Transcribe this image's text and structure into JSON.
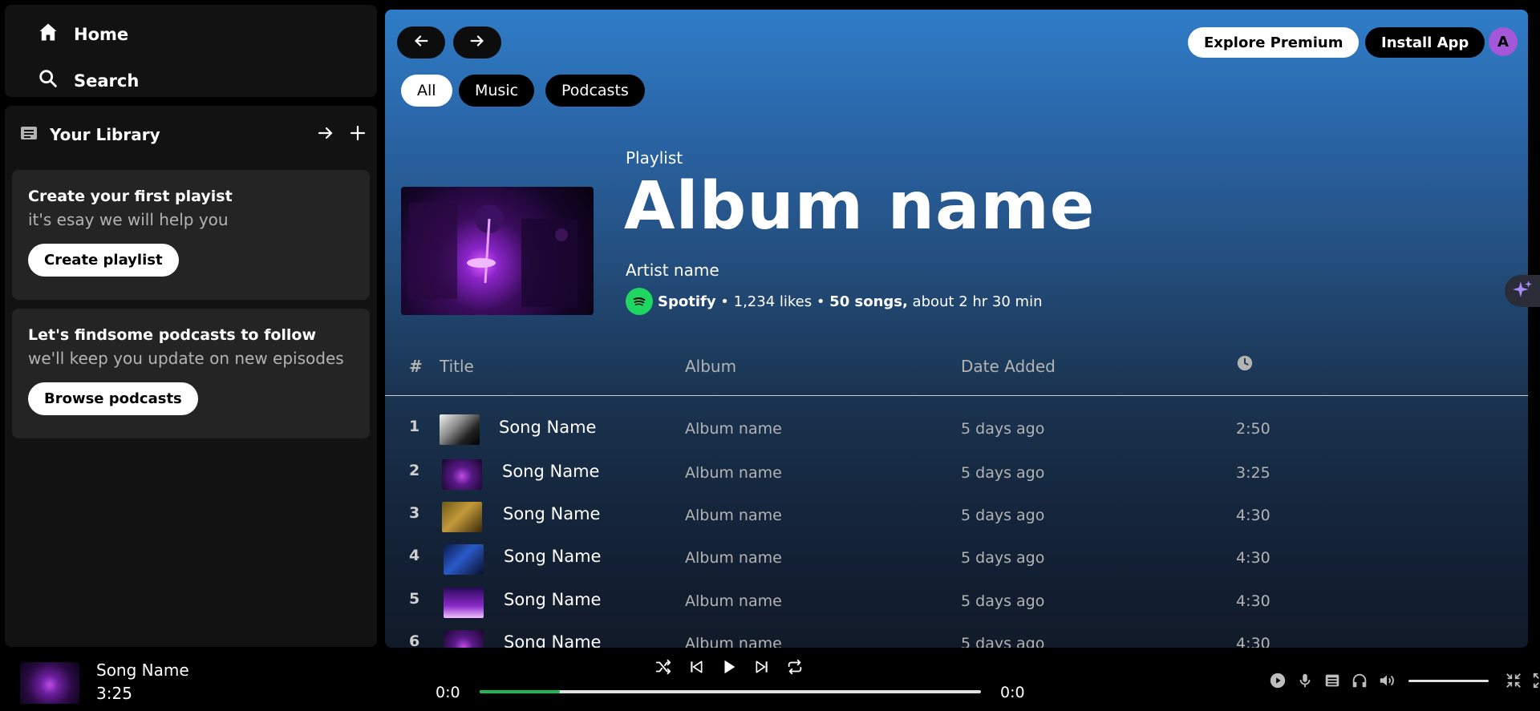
{
  "sidebar": {
    "home_label": "Home",
    "search_label": "Search",
    "library_title": "Your Library",
    "cards": [
      {
        "title": "Create your first playist",
        "subtitle": "it's esay we will help you",
        "button": "Create playlist"
      },
      {
        "title": "Let's findsome podcasts to follow",
        "subtitle": "we'll keep you update on new episodes",
        "button": "Browse podcasts"
      }
    ]
  },
  "topbar": {
    "explore_label": "Explore Premium",
    "install_label": "Install App",
    "avatar_initial": "A"
  },
  "filters": [
    "All",
    "Music",
    "Podcasts"
  ],
  "playlist": {
    "type": "Playlist",
    "title": "Album name",
    "artist": "Artist name",
    "owner": "Spotify",
    "likes": " • 1,234 likes • ",
    "songs": "50 songs,",
    "duration": " about 2 hr 30 min"
  },
  "table": {
    "headers": {
      "num": "#",
      "title": "Title",
      "album": "Album",
      "date": "Date Added"
    },
    "rows": [
      {
        "num": "1",
        "song": "Song Name",
        "album": "Album name",
        "date": "5 days ago",
        "duration": "2:50"
      },
      {
        "num": "2",
        "song": "Song Name",
        "album": "Album name",
        "date": "5 days ago",
        "duration": "3:25"
      },
      {
        "num": "3",
        "song": "Song Name",
        "album": "Album name",
        "date": "5 days ago",
        "duration": "4:30"
      },
      {
        "num": "4",
        "song": "Song Name",
        "album": "Album name",
        "date": "5 days ago",
        "duration": "4:30"
      },
      {
        "num": "5",
        "song": "Song Name",
        "album": "Album name",
        "date": "5 days ago",
        "duration": "4:30"
      },
      {
        "num": "6",
        "song": "Song Name",
        "album": "Album name",
        "date": "5 days ago",
        "duration": "4:30"
      }
    ]
  },
  "player": {
    "song": "Song Name",
    "song_time": "3:25",
    "elapsed": "0:0",
    "total": "0:0",
    "progress_fraction": 0.16
  },
  "colors": {
    "accent": "#1db954",
    "main_top": "#2f7dc8",
    "avatar": "#a557d9"
  }
}
